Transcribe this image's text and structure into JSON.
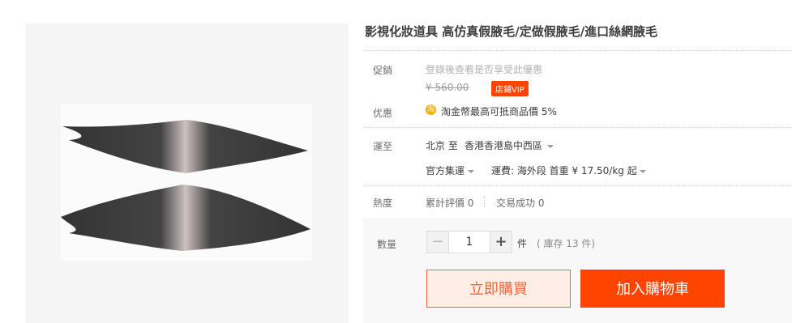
{
  "product": {
    "title": "影視化妝道具 高仿真假腋毛/定做假腋毛/進口絲網腋毛"
  },
  "promo": {
    "label": "促銷",
    "login_hint": "登錄後查看是否享受此優惠",
    "original_price": "¥ 560.00",
    "vip_badge": "店鋪VIP"
  },
  "benefit": {
    "label": "优惠",
    "coin_icon": "淘",
    "text": "淘金幣最高可抵商品價 5%"
  },
  "shipping": {
    "label": "運至",
    "from": "北京 至",
    "to": "香港香港島中西區",
    "method": "官方集運",
    "fee_label": "運費: 海外段 首重 ¥ 17.50/kg 起"
  },
  "popularity": {
    "label": "熱度",
    "reviews": "累計評價 0",
    "sales": "交易成功 0"
  },
  "quantity": {
    "label": "數量",
    "minus": "−",
    "value": "1",
    "plus": "+",
    "unit": "件",
    "stock": "( 庫存 13 件)"
  },
  "actions": {
    "buy_now": "立即購買",
    "add_to_cart": "加入購物車"
  },
  "colors": {
    "accent": "#ff4400",
    "buy_border": "#f0663a"
  }
}
